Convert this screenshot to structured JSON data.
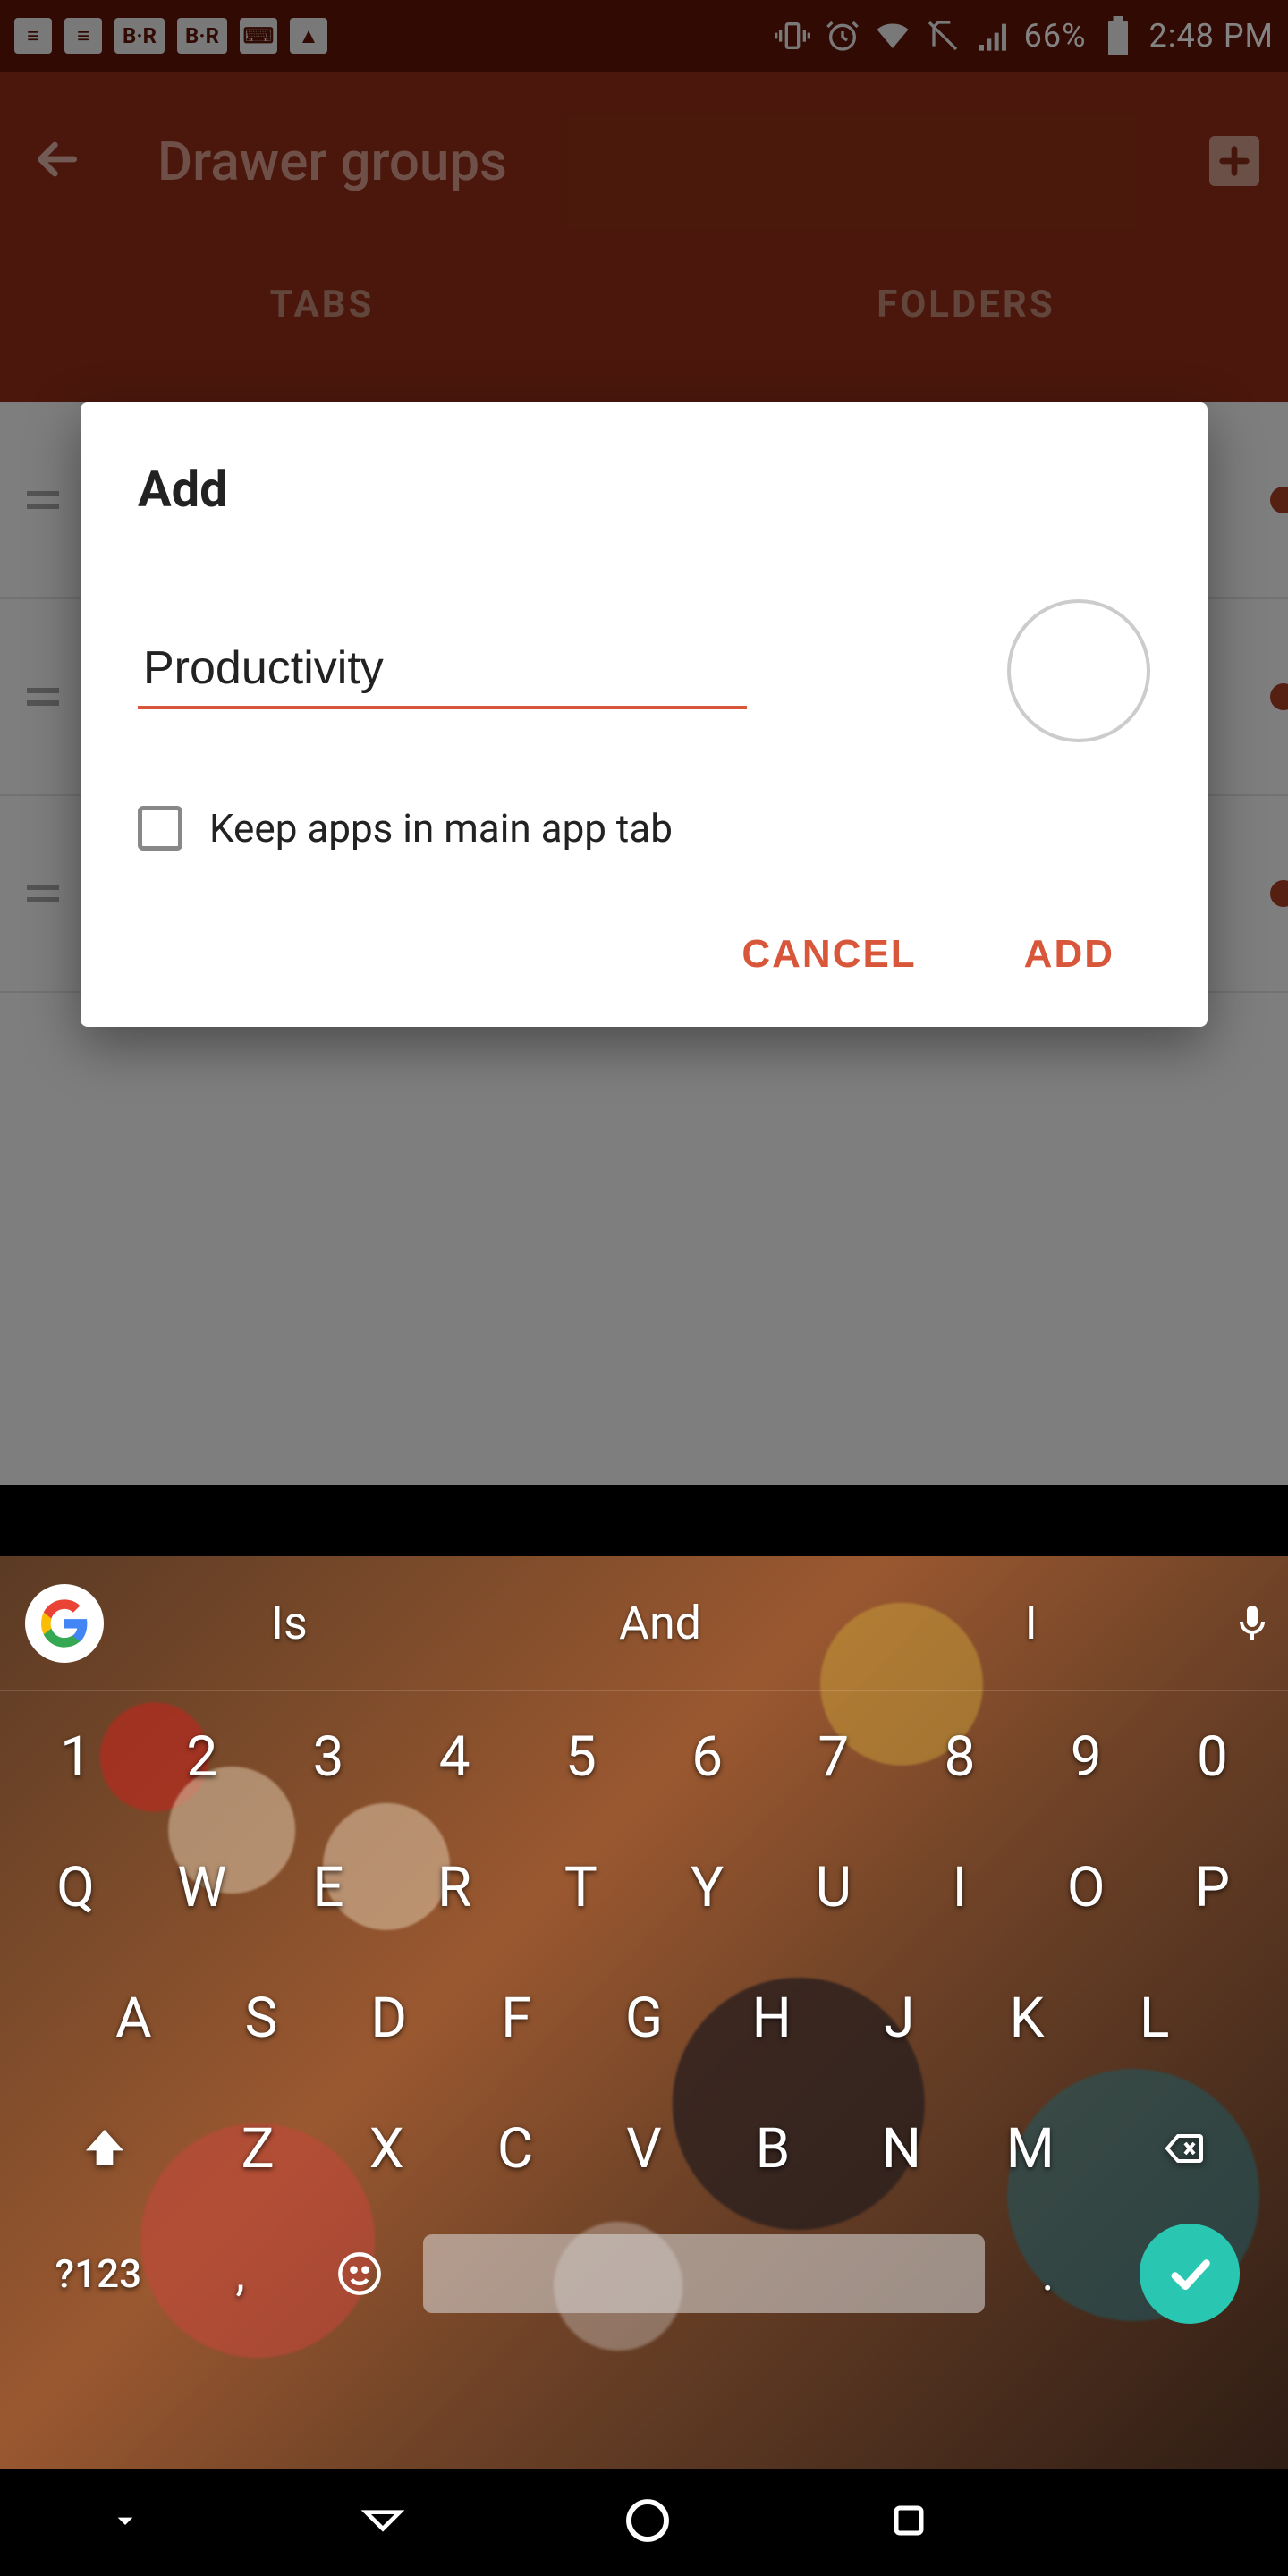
{
  "status": {
    "left_icons": [
      "app1",
      "app2",
      "BR",
      "BR",
      "keyboard",
      "photo"
    ],
    "battery_text": "66%",
    "time": "2:48 PM"
  },
  "header": {
    "title": "Drawer groups",
    "tabs": [
      "TABS",
      "FOLDERS"
    ]
  },
  "dialog": {
    "title": "Add",
    "input_value": "Productivity",
    "checkbox_label": "Keep apps in main app tab",
    "cancel": "CANCEL",
    "add": "ADD"
  },
  "keyboard": {
    "suggestions": [
      "Is",
      "And",
      "I"
    ],
    "row_num": [
      "1",
      "2",
      "3",
      "4",
      "5",
      "6",
      "7",
      "8",
      "9",
      "0"
    ],
    "row_q": [
      "Q",
      "W",
      "E",
      "R",
      "T",
      "Y",
      "U",
      "I",
      "O",
      "P"
    ],
    "row_a": [
      "A",
      "S",
      "D",
      "F",
      "G",
      "H",
      "J",
      "K",
      "L"
    ],
    "row_z": [
      "Z",
      "X",
      "C",
      "V",
      "B",
      "N",
      "M"
    ],
    "numsym": "?123",
    "comma": ",",
    "period": "."
  }
}
